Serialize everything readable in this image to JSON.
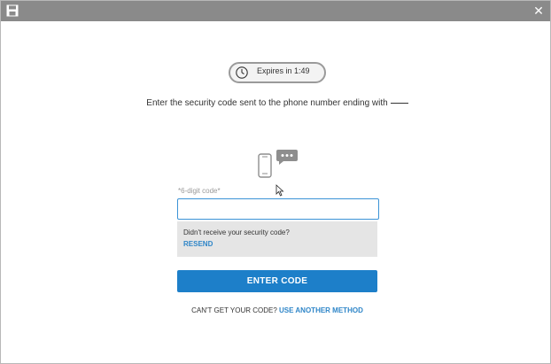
{
  "window": {
    "app_icon": "save-disk-icon",
    "close_glyph": "✕"
  },
  "timer": {
    "icon": "clock-icon",
    "text": "Expires in 1:49"
  },
  "instruction": {
    "text": "Enter the security code sent to the phone number ending with"
  },
  "illustration": {
    "icon": "phone-message-icon"
  },
  "code_field": {
    "label": "*6-digit code*",
    "value": "",
    "placeholder": ""
  },
  "resend": {
    "question": "Didn't receive your security code?",
    "link": "RESEND"
  },
  "submit": {
    "label": "ENTER CODE"
  },
  "alternative": {
    "prefix": "CAN'T GET YOUR CODE?",
    "link": "USE ANOTHER METHOD"
  },
  "colors": {
    "titlebar": "#8a8a8a",
    "accent": "#1d7fc9",
    "link": "#2f86c8",
    "input_border": "#3b93d6",
    "resend_bg": "#e5e5e5"
  }
}
